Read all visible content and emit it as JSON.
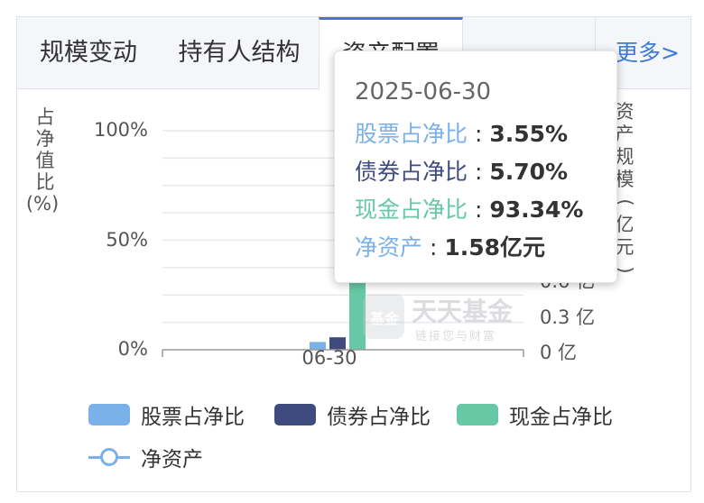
{
  "tabs": [
    {
      "label": "规模变动"
    },
    {
      "label": "持有人结构"
    },
    {
      "label": "资产配置"
    }
  ],
  "more_label": "更多>",
  "colors": {
    "stock": "#7bb1e9",
    "bond": "#3e4b7c",
    "cash": "#66c8a4",
    "net_assets": "#7bb1e9",
    "active_tab": "#3b7bd6"
  },
  "axis": {
    "left_label": "占净值比",
    "left_unit": "(%)",
    "right_label": "资产规模",
    "right_unit": "(亿元)",
    "left_ticks": [
      "100%",
      "50%",
      "0%"
    ],
    "right_ticks": [
      "0.6 亿",
      "0.3 亿",
      "0 亿"
    ],
    "x_ticks": [
      "06-30"
    ]
  },
  "chart_data": {
    "type": "bar",
    "categories": [
      "06-30"
    ],
    "series": [
      {
        "name": "股票占净比",
        "values": [
          3.55
        ]
      },
      {
        "name": "债券占净比",
        "values": [
          5.7
        ]
      },
      {
        "name": "现金占净比",
        "values": [
          93.34
        ]
      },
      {
        "name": "净资产",
        "values": [
          1.58
        ]
      }
    ],
    "ylim": [
      0,
      100
    ],
    "y2lim": [
      0,
      1.5
    ],
    "grid": true,
    "legend": "bottom"
  },
  "legend": [
    {
      "label": "股票占净比",
      "icon": "square"
    },
    {
      "label": "债券占净比",
      "icon": "square"
    },
    {
      "label": "现金占净比",
      "icon": "square"
    },
    {
      "label": "净资产",
      "icon": "line-circle"
    }
  ],
  "watermark": {
    "title": "天天基金",
    "subtitle": "链接您与财富",
    "logo_text": "基金"
  },
  "tooltip": {
    "date": "2025-06-30",
    "rows": [
      {
        "label": "股票占净比",
        "sep": ":",
        "value": "3.55%",
        "color": "#7bb1e9"
      },
      {
        "label": "债券占净比",
        "sep": ":",
        "value": "5.70%",
        "color": "#3e4b7c"
      },
      {
        "label": "现金占净比",
        "sep": ":",
        "value": "93.34%",
        "color": "#66c8a4"
      },
      {
        "label": "净资产",
        "sep": ":",
        "value": "1.58亿元",
        "color": "#7bb1e9"
      }
    ]
  }
}
